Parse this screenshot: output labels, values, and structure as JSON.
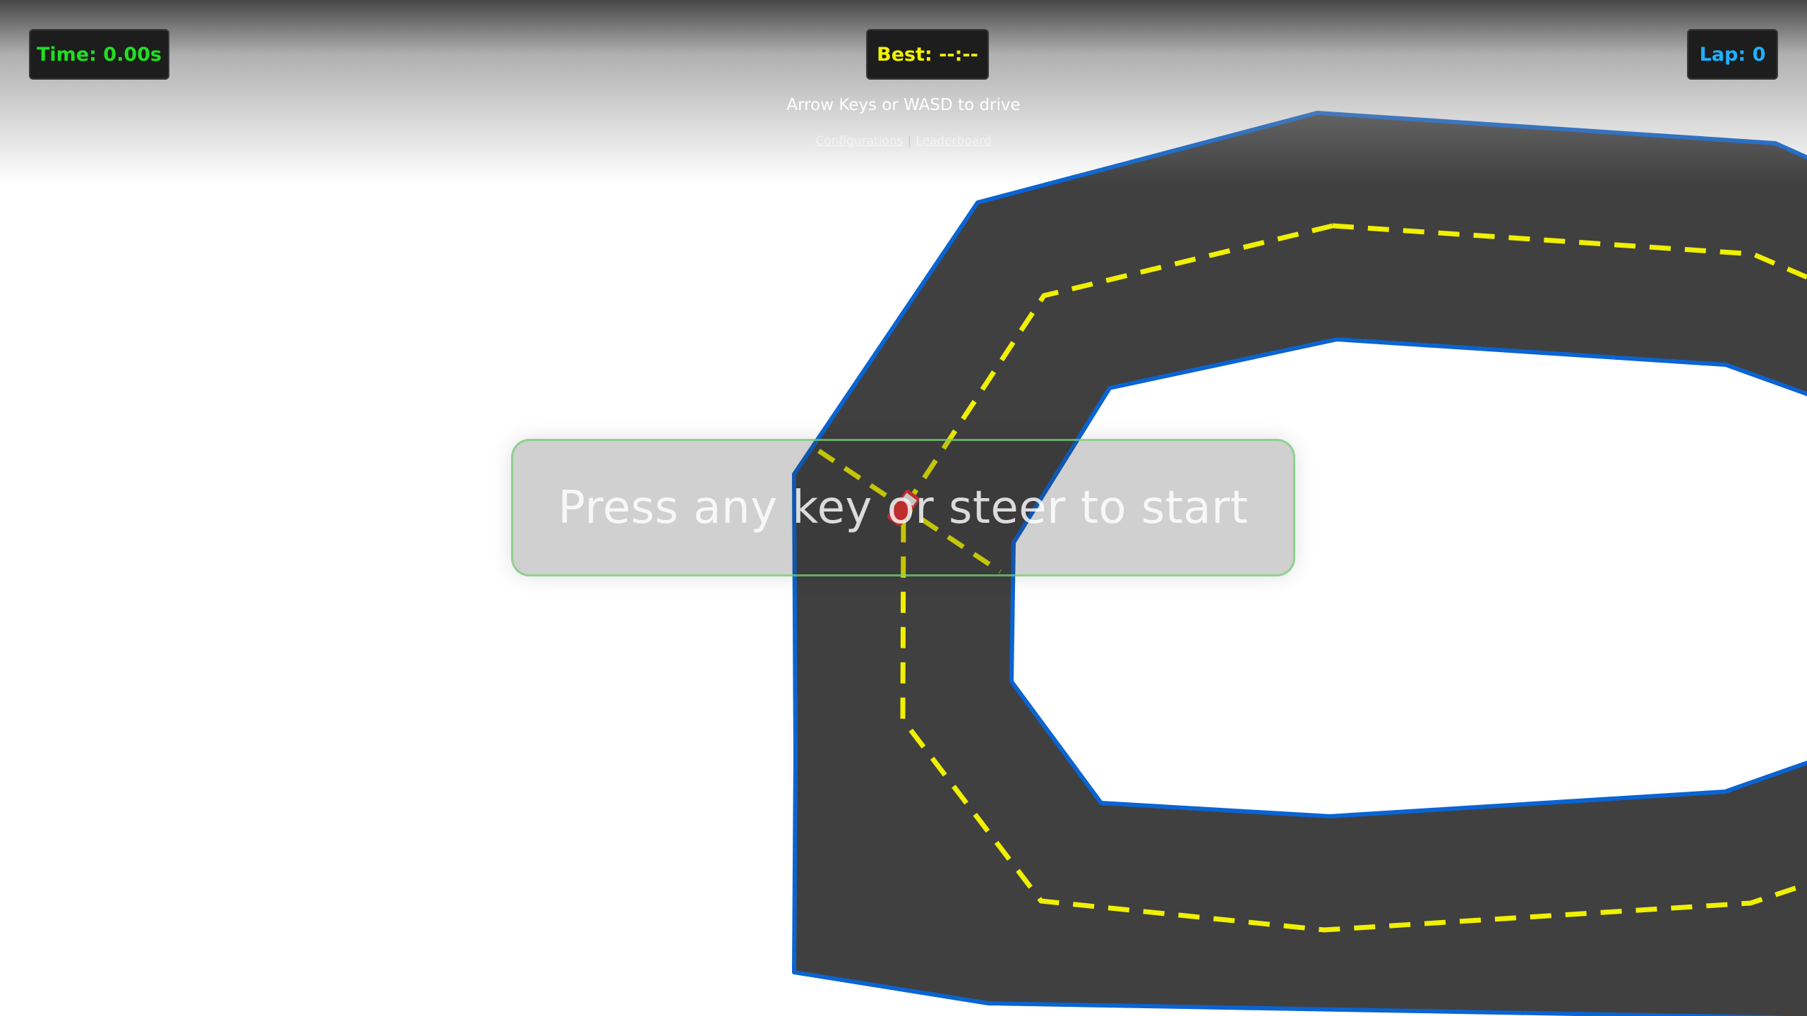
{
  "hud": {
    "time_text": "Time: 0.00s",
    "best_text": "Best: --:--",
    "lap_text": "Lap: 0"
  },
  "instructions": "Arrow Keys or WASD to drive",
  "links": {
    "left": "Configurations",
    "separator": "|",
    "right": "Leaderboard"
  },
  "overlay": {
    "start_message": "Press any key or steer to start"
  },
  "colors": {
    "track_surface": "#404040",
    "track_border": "#0a64d2",
    "center_line": "#f0f000",
    "car": "#e83030",
    "time_text": "#22dd22",
    "best_text": "#f2f200",
    "lap_text": "#1fb0ff"
  }
}
